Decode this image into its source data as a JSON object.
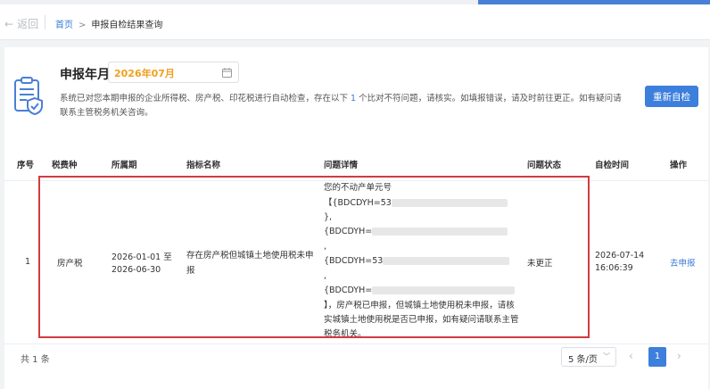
{
  "nav": {
    "back_label": "返回",
    "breadcrumb_home": "首页",
    "breadcrumb_sep": ">",
    "breadcrumb_current": "申报自检结果查询"
  },
  "header": {
    "title": "申报年月",
    "date_value": "2026年07月",
    "description_prefix": "系统已对您本期申报的企业所得税、房产税、印花税进行自动检查，存在以下",
    "description_count": "1",
    "description_mid": "个比对不符问题，请核实。如填报错误，请及时前往更正。如有疑问请",
    "description_line2": "联系主管税务机关咨询。",
    "recheck_label": "重新自检"
  },
  "table": {
    "headers": [
      "序号",
      "税费种",
      "所属期",
      "指标名称",
      "问题详情",
      "问题状态",
      "自检时间",
      "操作"
    ],
    "rows": [
      {
        "index": "1",
        "tax_type": "房产税",
        "period_line1": "2026-01-01 至",
        "period_line2": "2026-06-30",
        "indicator_line1": "存在房产税但城镇土地使用税未申",
        "indicator_line2": "报",
        "issue_lines": [
          "您的不动产单元号",
          "【{BDCDYH=53",
          "},",
          "{BDCDYH=",
          ",",
          "{BDCDYH=53",
          ",",
          "{BDCDYH=",
          "】，房产税已申报，但城镇土地使用税未申报，请核",
          "实城镇土地使用税是否已申报，如有疑问请联系主管",
          "税务机关。"
        ],
        "status": "未更正",
        "check_time_line1": "2026-07-14",
        "check_time_line2": "16:06:39",
        "action": "去申报"
      }
    ]
  },
  "footer": {
    "total": "共 1 条",
    "page_size": "5 条/页",
    "current_page": "1",
    "prev": "‹",
    "next": "›"
  },
  "colors": {
    "accent": "#3d7fdc",
    "date_text": "#f0a020",
    "highlight_border": "#d23b40"
  },
  "icons": [
    "back-arrow-icon",
    "document-shield-icon",
    "calendar-icon",
    "chevron-down-icon"
  ]
}
